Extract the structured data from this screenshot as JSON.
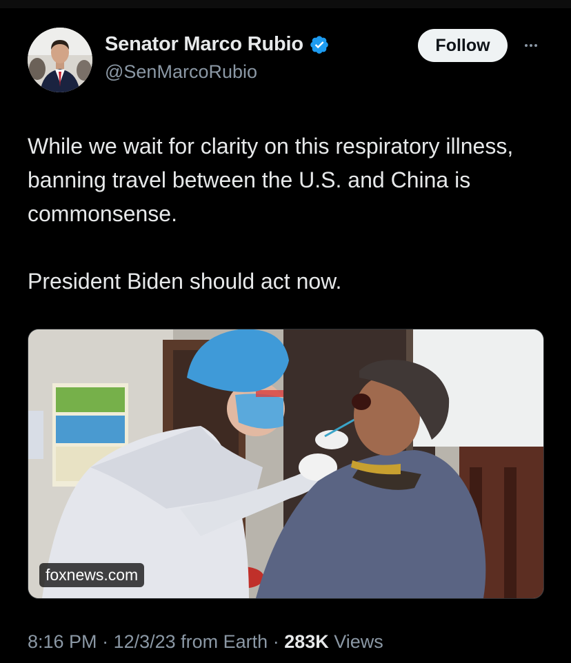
{
  "author": {
    "name": "Senator Marco Rubio",
    "handle": "@SenMarcoRubio",
    "verified": true,
    "verified_color": "#1d9bf0"
  },
  "actions": {
    "follow_label": "Follow"
  },
  "tweet": {
    "paragraphs": [
      "While we wait for clarity on this respiratory illness, banning travel between the U.S. and China is commonsense.",
      "President Biden should act now."
    ]
  },
  "link_card": {
    "domain": "foxnews.com"
  },
  "meta": {
    "time": "8:16 PM",
    "sep1": " · ",
    "date": "12/3/23",
    "location": " from Earth",
    "sep2": " · ",
    "views_count": "283K",
    "views_label": " Views"
  },
  "colors": {
    "background": "#000000",
    "text": "#e7e9ea",
    "secondary": "#8b98a5",
    "follow_bg": "#eff3f4"
  },
  "icons": {
    "verified": "verified-badge-icon",
    "more": "more-icon"
  }
}
